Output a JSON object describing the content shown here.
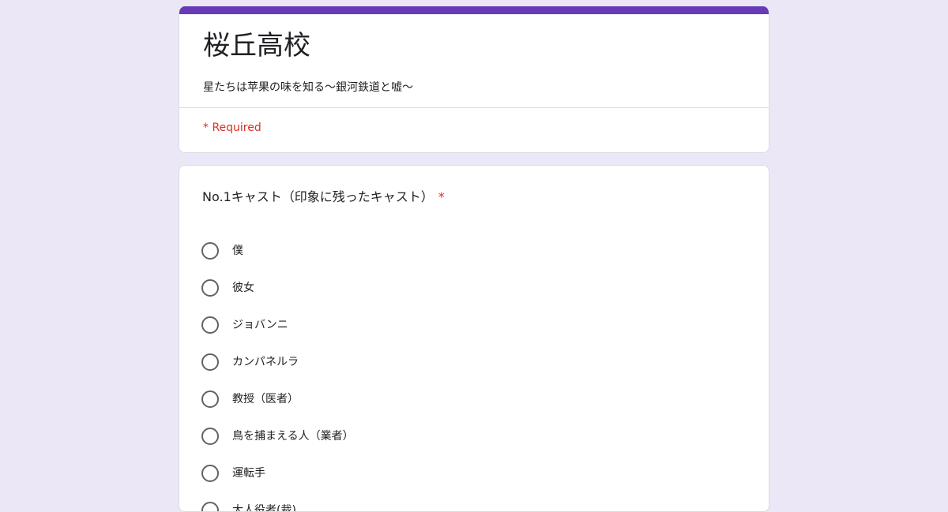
{
  "form": {
    "title": "桜丘高校",
    "description": "星たちは苹果の味を知る〜銀河鉄道と嘘〜",
    "required_note": "* Required",
    "accent_color": "#673ab7",
    "background_color": "#ece7f7",
    "required_color": "#d93025"
  },
  "question": {
    "title": "No.1キャスト（印象に残ったキャスト）",
    "required_star": "*",
    "options": [
      {
        "label": "僕"
      },
      {
        "label": "彼女"
      },
      {
        "label": "ジョバンニ"
      },
      {
        "label": "カンパネルラ"
      },
      {
        "label": "教授（医者）"
      },
      {
        "label": "鳥を捕まえる人（業者）"
      },
      {
        "label": "運転手"
      },
      {
        "label": "大人役者(裁)"
      }
    ]
  }
}
